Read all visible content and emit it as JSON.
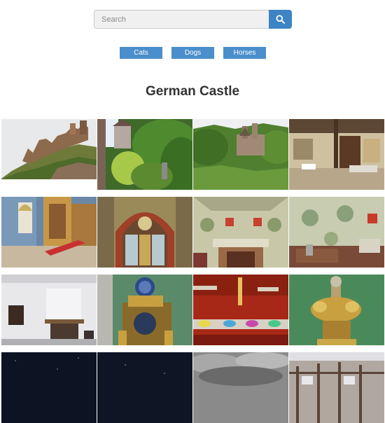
{
  "search": {
    "placeholder": "Search",
    "button_icon": "search-icon"
  },
  "categories": [
    "Cats",
    "Dogs",
    "Horses"
  ],
  "title": "German Castle",
  "colors": {
    "accent": "#3d84c4",
    "category_button": "#4a8ecb",
    "title_text": "#333333"
  },
  "gallery": [
    "castle-on-hill-photo",
    "castle-forest-tower-photo",
    "castle-valley-photo",
    "castle-hall-interior-photo",
    "gothic-chapel-photo",
    "gothic-window-photo",
    "painted-fireplace-photo",
    "painted-room-photo",
    "white-room-fireplace-photo",
    "ornate-gold-clock-photo",
    "treasury-display-photo",
    "gold-centerpiece-photo",
    "night-sky-photo",
    "night-sky-photo-2",
    "cloudy-sky-photo",
    "half-timbered-house-photo"
  ]
}
